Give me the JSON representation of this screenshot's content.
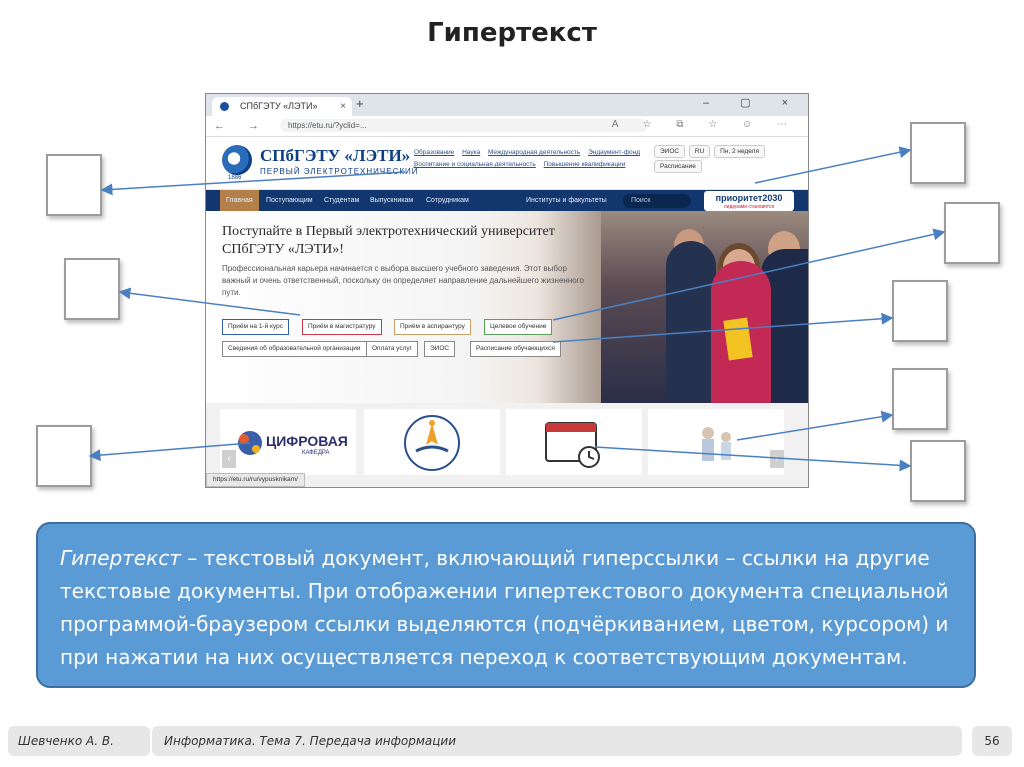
{
  "slide": {
    "title": "Гипертекст",
    "footer_author": "Шевченко А. В.",
    "footer_course": "Информатика. Тема 7. Передача информации",
    "page_number": "56"
  },
  "browser": {
    "tab_title": "СПбГЭТУ «ЛЭТИ»",
    "tab_close": "×",
    "new_tab": "+",
    "window_controls": "– ▢ ×",
    "nav_icons": "← → ↻",
    "url": "https://etu.ru/?yclid=...",
    "toolbar_icons": "A ☆ ⧉ ☆ ☺ ⋯",
    "status_url": "https://etu.ru/ru/vypusknikam/"
  },
  "site": {
    "logo_year": "1886",
    "name": "СПбГЭТУ «ЛЭТИ»",
    "subtitle": "ПЕРВЫЙ ЭЛЕКТРОТЕХНИЧЕСКИЙ",
    "top_links": [
      "Образование",
      "Наука",
      "Международная деятельность",
      "Эндаумент-фонд",
      "Воспитание и социальная деятельность",
      "Повышение квалификации"
    ],
    "header_chips": [
      "ЭИОС",
      "RU",
      "Пн, 2 неделя",
      "Расписание"
    ],
    "menu": [
      "Главная",
      "Поступающим",
      "Студентам",
      "Выпускникам",
      "Сотрудникам",
      "Институты и факультеты"
    ],
    "search_placeholder": "Поиск",
    "priority_label": "приоритет2030",
    "priority_sub": "лидерами становятся",
    "hero_title": "Поступайте в Первый электротехнический университет СПбГЭТУ «ЛЭТИ»!",
    "hero_text": "Профессиональная карьера начинается с выбора высшего учебного заведения. Этот выбор важный и очень ответственный, поскольку он определяет направление дальнейшего жизненного пути.",
    "buttons_row1": [
      "Приём на 1-й курс",
      "Приём в магистратуру",
      "Приём в аспирантуру",
      "Целевое обучение"
    ],
    "buttons_row2": [
      "Сведения об образовательной организации",
      "Оплата услуг",
      "ЭИОС",
      "Расписание обучающихся"
    ],
    "card_digital": "ЦИФРОВАЯ",
    "card_digital_sub": "КАФЕДРА"
  },
  "definition": {
    "term": "Гипертекст",
    "body": " – текстовый документ, включающий гиперссылки – ссылки на другие текстовые документы. При отображении гипертекстового документа специальной программой-браузером ссылки выделяются (подчёркиванием, цветом, курсором) и при нажатии на них осуществляется переход к соответствующим документам."
  }
}
